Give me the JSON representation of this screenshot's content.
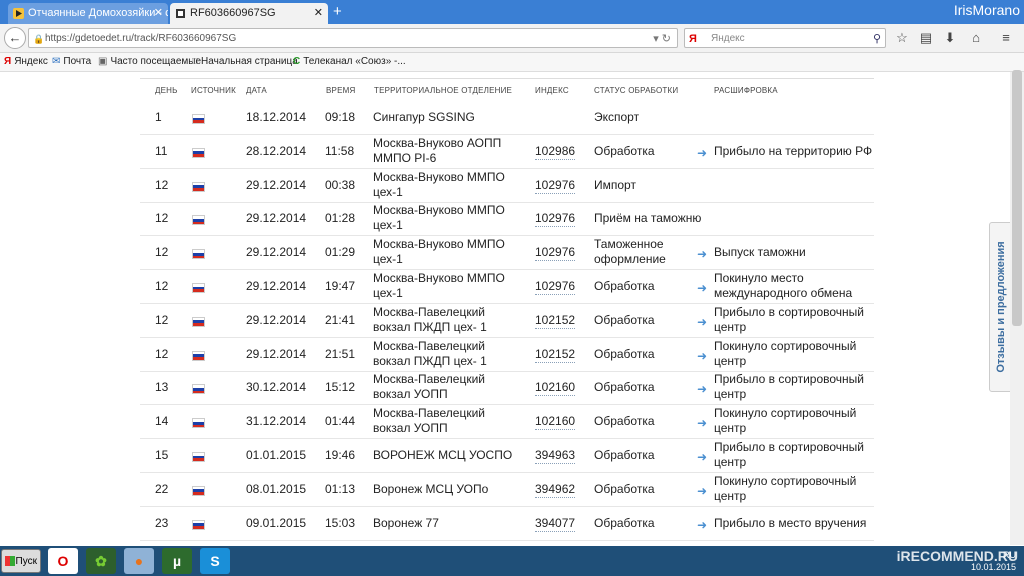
{
  "browser": {
    "tabs": [
      {
        "label": "Отчаянные Домохозяйки - с..."
      },
      {
        "label": "RF603660967SG"
      }
    ],
    "new_tab": "+",
    "user": "IrisMorano",
    "url": "https://gdetoedet.ru/track/RF603660967SG",
    "search_placeholder": "Яндекс",
    "search_engine_letter": "Я",
    "bookmarks": [
      {
        "label": "Яндекс",
        "icon": "yandex-icon"
      },
      {
        "label": "Почта",
        "icon": "mail-icon"
      },
      {
        "label": "Часто посещаемые",
        "icon": "folder-icon"
      },
      {
        "label": "Начальная страница",
        "icon": "page-icon"
      },
      {
        "label": "Телеканал «Союз» -...",
        "icon": "soyuz-icon"
      }
    ]
  },
  "table": {
    "headers": {
      "day": "День",
      "source": "Источник",
      "date": "Дата",
      "time": "Время",
      "office": "Территориальное отделение",
      "index": "Индекс",
      "status": "Статус обработки",
      "decode": "Расшифровка"
    },
    "rows": [
      {
        "day": "1",
        "date": "18.12.2014",
        "time": "09:18",
        "office": [
          "Сингапур SGSING"
        ],
        "index": "",
        "status": [
          "Экспорт"
        ],
        "decode": []
      },
      {
        "day": "11",
        "date": "28.12.2014",
        "time": "11:58",
        "office": [
          "Москва-Внуково АОПП",
          "ММПО PI-6"
        ],
        "index": "102986",
        "status": [
          "Обработка"
        ],
        "decode": [
          "Прибыло на территорию РФ"
        ]
      },
      {
        "day": "12",
        "date": "29.12.2014",
        "time": "00:38",
        "office": [
          "Москва-Внуково ММПО",
          "цех-1"
        ],
        "index": "102976",
        "status": [
          "Импорт"
        ],
        "decode": []
      },
      {
        "day": "12",
        "date": "29.12.2014",
        "time": "01:28",
        "office": [
          "Москва-Внуково ММПО",
          "цех-1"
        ],
        "index": "102976",
        "status": [
          "Приём на таможню"
        ],
        "decode": []
      },
      {
        "day": "12",
        "date": "29.12.2014",
        "time": "01:29",
        "office": [
          "Москва-Внуково ММПО",
          "цех-1"
        ],
        "index": "102976",
        "status": [
          "Таможенное",
          "оформление"
        ],
        "decode": [
          "Выпуск таможни"
        ]
      },
      {
        "day": "12",
        "date": "29.12.2014",
        "time": "19:47",
        "office": [
          "Москва-Внуково ММПО",
          "цех-1"
        ],
        "index": "102976",
        "status": [
          "Обработка"
        ],
        "decode": [
          "Покинуло место",
          "международного обмена"
        ]
      },
      {
        "day": "12",
        "date": "29.12.2014",
        "time": "21:41",
        "office": [
          "Москва-Павелецкий",
          "вокзал ПЖДП цех- 1"
        ],
        "index": "102152",
        "status": [
          "Обработка"
        ],
        "decode": [
          "Прибыло в сортировочный",
          "центр"
        ]
      },
      {
        "day": "12",
        "date": "29.12.2014",
        "time": "21:51",
        "office": [
          "Москва-Павелецкий",
          "вокзал ПЖДП цех- 1"
        ],
        "index": "102152",
        "status": [
          "Обработка"
        ],
        "decode": [
          "Покинуло сортировочный",
          "центр"
        ]
      },
      {
        "day": "13",
        "date": "30.12.2014",
        "time": "15:12",
        "office": [
          "Москва-Павелецкий",
          "вокзал УОПП"
        ],
        "index": "102160",
        "status": [
          "Обработка"
        ],
        "decode": [
          "Прибыло в сортировочный",
          "центр"
        ]
      },
      {
        "day": "14",
        "date": "31.12.2014",
        "time": "01:44",
        "office": [
          "Москва-Павелецкий",
          "вокзал УОПП"
        ],
        "index": "102160",
        "status": [
          "Обработка"
        ],
        "decode": [
          "Покинуло сортировочный",
          "центр"
        ]
      },
      {
        "day": "15",
        "date": "01.01.2015",
        "time": "19:46",
        "office": [
          "ВОРОНЕЖ МСЦ УОСПО"
        ],
        "index": "394963",
        "status": [
          "Обработка"
        ],
        "decode": [
          "Прибыло в сортировочный",
          "центр"
        ]
      },
      {
        "day": "22",
        "date": "08.01.2015",
        "time": "01:13",
        "office": [
          "Воронеж МСЦ УОПо"
        ],
        "index": "394962",
        "status": [
          "Обработка"
        ],
        "decode": [
          "Покинуло сортировочный",
          "центр"
        ]
      },
      {
        "day": "23",
        "date": "09.01.2015",
        "time": "15:03",
        "office": [
          "Воронеж 77"
        ],
        "index": "394077",
        "status": [
          "Обработка"
        ],
        "decode": [
          "Прибыло в место вручения"
        ]
      }
    ],
    "flag_colors": [
      "#ffffff",
      "#1c3fa8",
      "#d52b1e"
    ]
  },
  "feedback_tab": "Отзывы и предложения",
  "taskbar": {
    "start": "Пуск",
    "tray_lang": "RU",
    "tray_date": "10.01.2015"
  },
  "watermark": "iRECOMMEND.RU"
}
